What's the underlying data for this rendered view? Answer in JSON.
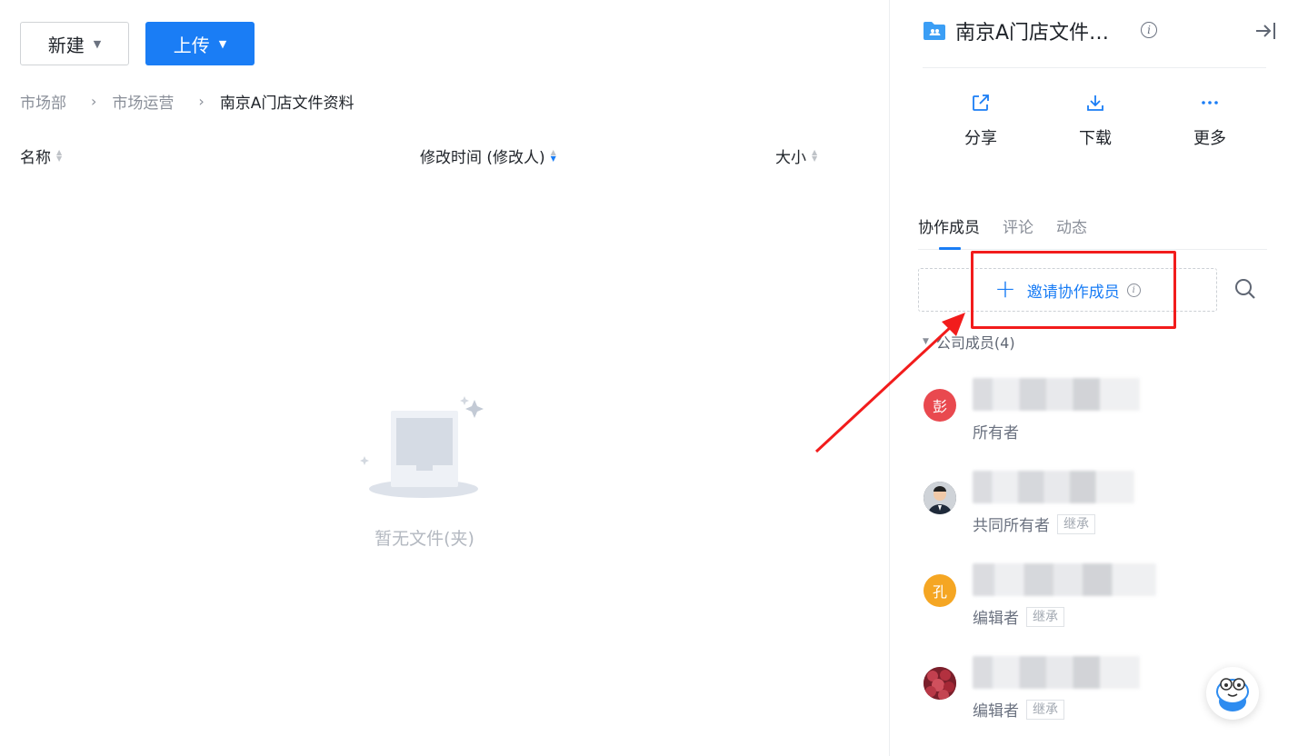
{
  "toolbar": {
    "new_label": "新建",
    "upload_label": "上传"
  },
  "breadcrumb": [
    "市场部",
    "市场运营",
    "南京A门店文件资料"
  ],
  "columns": {
    "name": "名称",
    "modified": "修改时间 (修改人)",
    "size": "大小"
  },
  "empty_text": "暂无文件(夹)",
  "panel": {
    "title": "南京A门店文件…",
    "actions": [
      {
        "label": "分享",
        "icon": "share-icon"
      },
      {
        "label": "下载",
        "icon": "download-icon"
      },
      {
        "label": "更多",
        "icon": "more-icon"
      }
    ],
    "tabs": [
      "协作成员",
      "评论",
      "动态"
    ],
    "invite_label": "邀请协作成员",
    "group_label": "公司成员(4)",
    "members": [
      {
        "avatar_text": "彭",
        "avatar_color": "#e9494f",
        "role": "所有者",
        "inherit": ""
      },
      {
        "avatar_text": "",
        "avatar_color": "#3a3f4a",
        "role": "共同所有者",
        "inherit": "继承"
      },
      {
        "avatar_text": "孔",
        "avatar_color": "#f5a623",
        "role": "编辑者",
        "inherit": "继承"
      },
      {
        "avatar_text": "",
        "avatar_color": "#a83a44",
        "role": "编辑者",
        "inherit": "继承"
      }
    ]
  },
  "colors": {
    "primary": "#1a7df5",
    "annotation": "#f21c1c"
  }
}
